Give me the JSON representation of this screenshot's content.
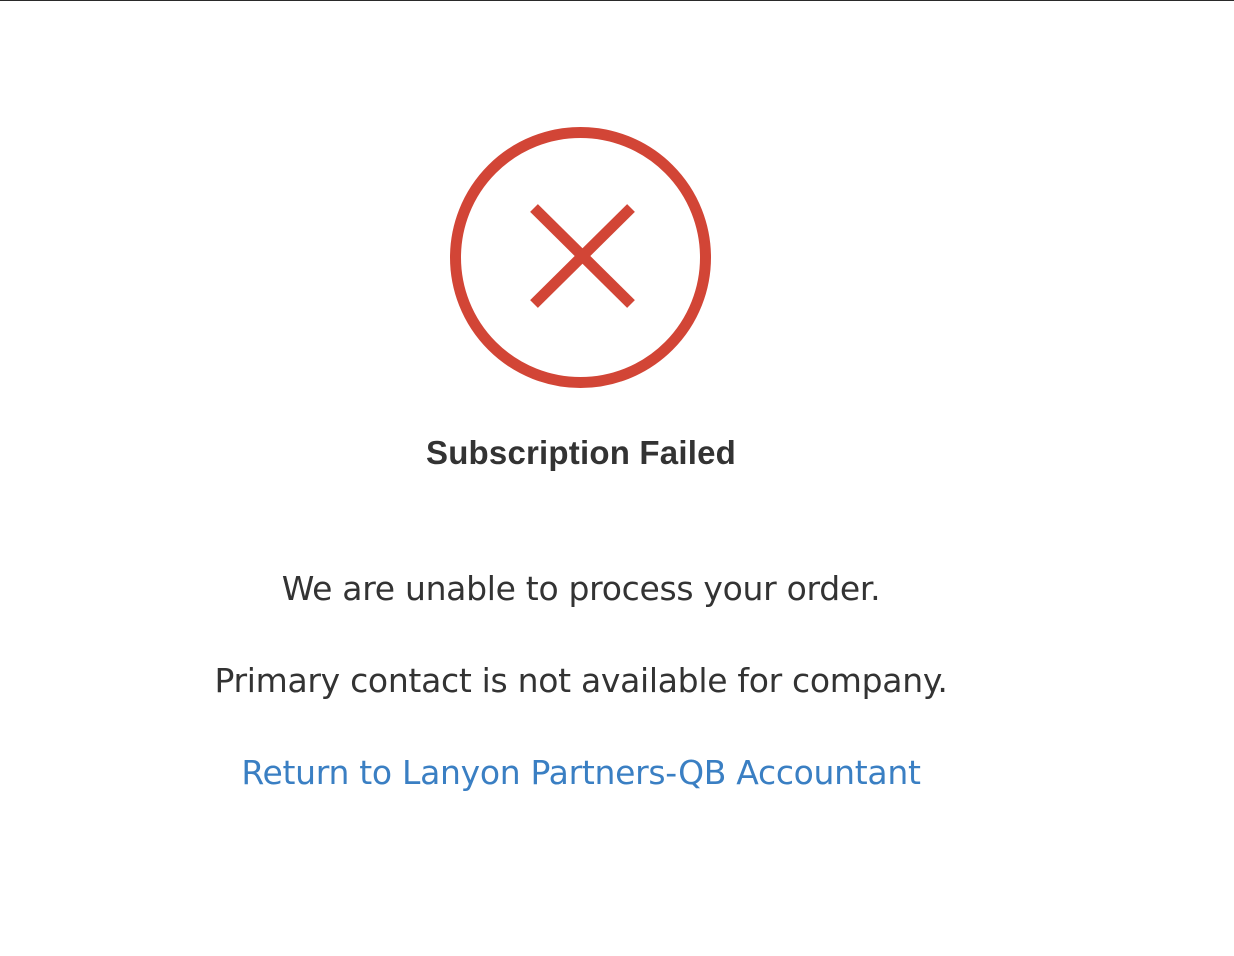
{
  "status": {
    "icon": "error-x-circle-icon",
    "icon_color": "#d24536",
    "title": "Subscription Failed"
  },
  "messages": {
    "primary": "We are unable to process your order.",
    "detail": "Primary contact is not available for company."
  },
  "link": {
    "label": "Return to Lanyon Partners-QB Accountant",
    "color": "#3a7fc3"
  }
}
